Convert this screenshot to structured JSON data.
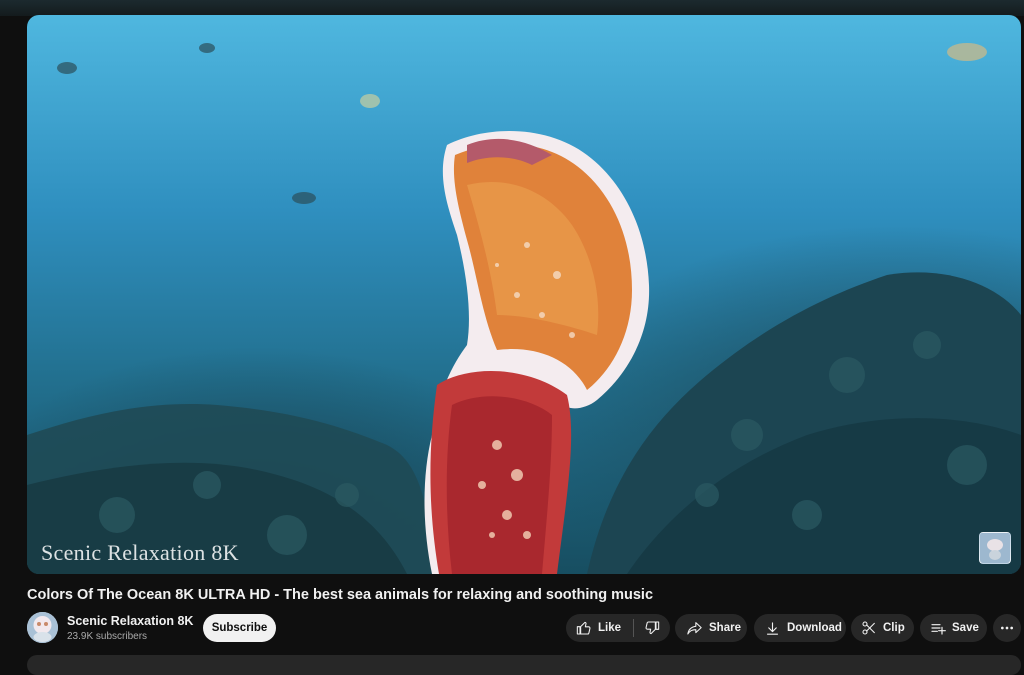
{
  "video": {
    "watermark": "Scenic Relaxation 8K",
    "title": "Colors Of The Ocean 8K ULTRA HD - The best sea animals for relaxing and soothing music"
  },
  "channel": {
    "name": "Scenic Relaxation 8K",
    "subscribers": "23.9K subscribers",
    "subscribe_label": "Subscribe"
  },
  "actions": {
    "like": "Like",
    "share": "Share",
    "download": "Download",
    "clip": "Clip",
    "save": "Save"
  },
  "icons": {
    "like": "thumbs-up-icon",
    "dislike": "thumbs-down-icon",
    "share": "share-arrow-icon",
    "download": "download-icon",
    "clip": "scissors-icon",
    "save": "playlist-add-icon",
    "more": "more-horizontal-icon"
  },
  "colors": {
    "page_background": "#0f0f0f",
    "button_background": "#272727",
    "subscribe_background": "#f1f1f1",
    "text_primary": "#f1f1f1",
    "text_secondary": "#aaaaaa"
  }
}
